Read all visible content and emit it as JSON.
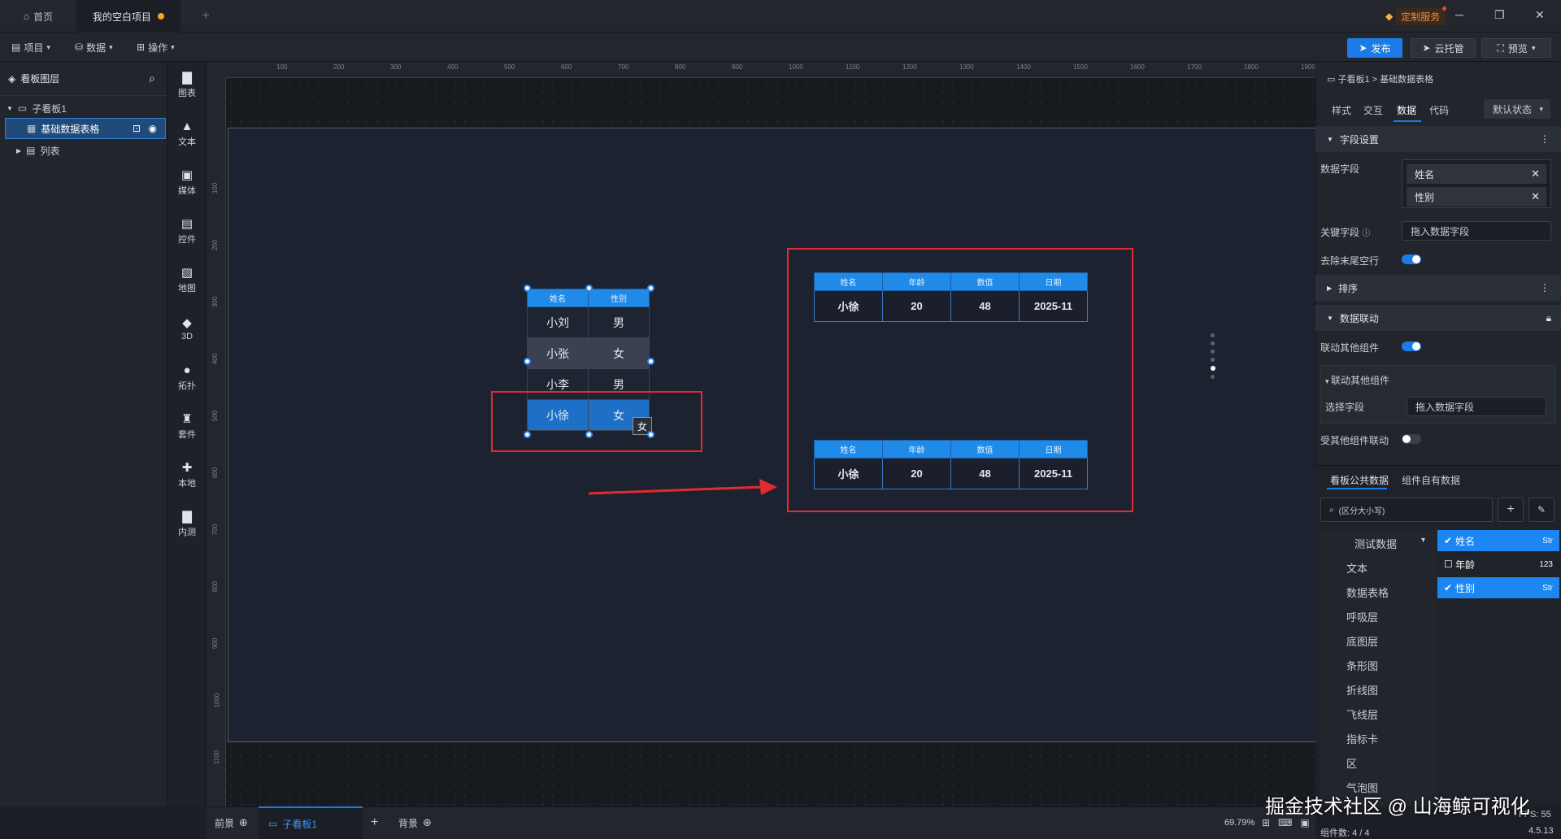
{
  "titlebar": {
    "home_tab": "首页",
    "project_tab": "我的空白项目",
    "service_badge": "定制服务"
  },
  "menubar": {
    "project": "项目",
    "data": "数据",
    "operate": "操作",
    "publish": "发布",
    "cloud": "云托管",
    "preview": "预览"
  },
  "layers": {
    "title": "看板图层",
    "items": [
      {
        "label": "子看板1"
      },
      {
        "label": "基础数据表格"
      },
      {
        "label": "列表"
      }
    ]
  },
  "tools": [
    "图表",
    "文本",
    "媒体",
    "控件",
    "地图",
    "3D",
    "拓扑",
    "套件",
    "本地",
    "内测"
  ],
  "ruler_top": [
    "100",
    "200",
    "300",
    "400",
    "500",
    "600",
    "700",
    "800",
    "900",
    "1000",
    "1100",
    "1200",
    "1300",
    "1400",
    "1500",
    "1600",
    "1700",
    "1800",
    "1900"
  ],
  "ruler_left": [
    "100",
    "200",
    "300",
    "400",
    "500",
    "600",
    "700",
    "800",
    "900",
    "1000",
    "1100"
  ],
  "small_table": {
    "headers": [
      "姓名",
      "性别"
    ],
    "rows": [
      [
        "小刘",
        "男"
      ],
      [
        "小张",
        "女"
      ],
      [
        "小李",
        "男"
      ],
      [
        "小徐",
        "女"
      ]
    ],
    "tooltip": "女"
  },
  "big_table": {
    "headers": [
      "姓名",
      "年龄",
      "数值",
      "日期"
    ],
    "row": [
      "小徐",
      "20",
      "48",
      "2025-11"
    ]
  },
  "props": {
    "breadcrumb": "子看板1 > 基础数据表格",
    "tabs": [
      "样式",
      "交互",
      "数据",
      "代码"
    ],
    "state_select": "默认状态",
    "section_fields": "字段设置",
    "label_data_field": "数据字段",
    "field_chips": [
      "姓名",
      "性别"
    ],
    "label_key_field": "关键字段",
    "key_placeholder": "拖入数据字段",
    "label_trim_empty": "去除末尾空行",
    "section_sort": "排序",
    "section_link": "数据联动",
    "label_link_other": "联动其他组件",
    "sub_link_other": "联动其他组件",
    "label_select_field": "选择字段",
    "select_placeholder": "拖入数据字段",
    "label_linked_by": "受其他组件联动",
    "data_tabs": [
      "看板公共数据",
      "组件自有数据"
    ],
    "search_placeholder": "(区分大小写)",
    "dataset": "测试数据",
    "categories": [
      "文本",
      "数据表格",
      "呼吸层",
      "底图层",
      "条形图",
      "折线图",
      "飞线层",
      "指标卡",
      "区",
      "气泡图"
    ],
    "fields": [
      {
        "name": "姓名",
        "type": "Str",
        "checked": true
      },
      {
        "name": "年龄",
        "type": "123",
        "checked": false
      },
      {
        "name": "性别",
        "type": "Str",
        "checked": true
      }
    ]
  },
  "bottom": {
    "front": "前景",
    "sub_board": "子看板1",
    "background": "背景",
    "zoom": "69.79%",
    "component_count": "组件数: 4 / 4",
    "fps": "FPS: 55",
    "version": "4.5.13"
  },
  "watermark": "掘金技术社区 @ 山海鲸可视化"
}
